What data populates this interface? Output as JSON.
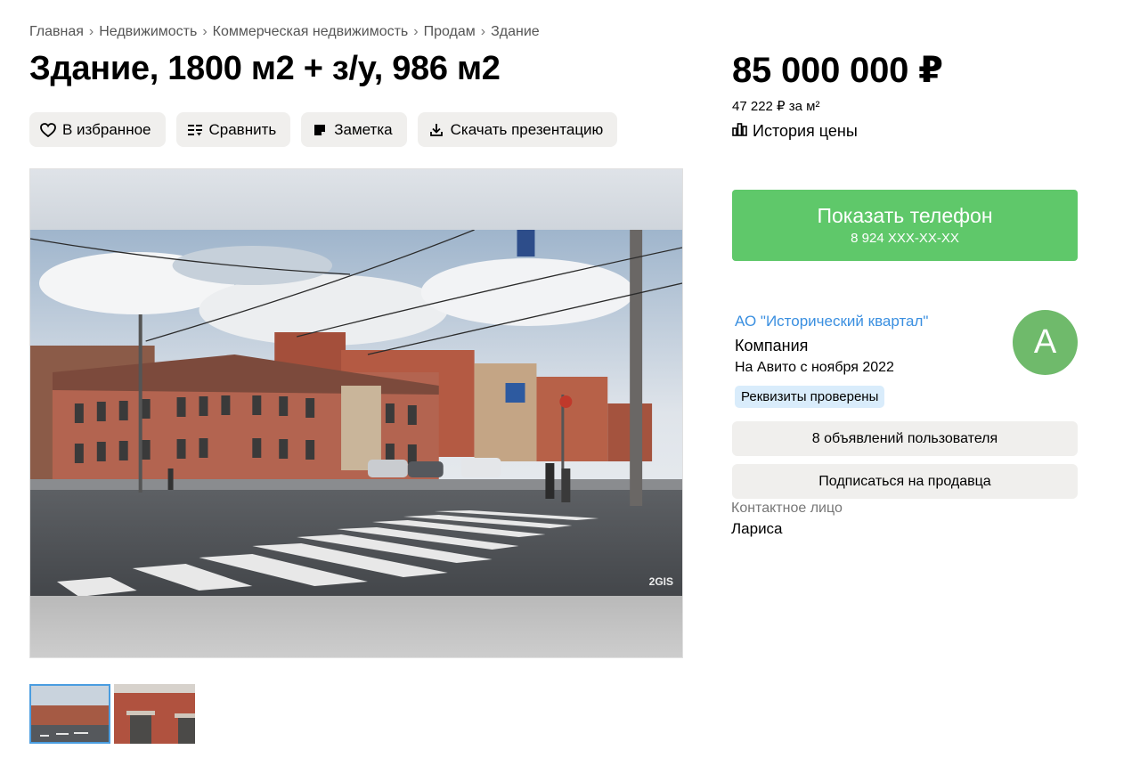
{
  "breadcrumb": [
    "Главная",
    "Недвижимость",
    "Коммерческая недвижимость",
    "Продам",
    "Здание"
  ],
  "title": "Здание, 1800 м2 + з/у, 986 м2",
  "actions": {
    "favorite": "В избранное",
    "compare": "Сравнить",
    "note": "Заметка",
    "download": "Скачать презентацию"
  },
  "icons": {
    "favorite": "heart-icon",
    "compare": "compare-icon",
    "note": "note-icon",
    "download": "download-icon",
    "history": "chart-icon"
  },
  "photo": {
    "watermark": "2GIS"
  },
  "price": {
    "total": "85 000 000 ₽",
    "per_m2": "47 222 ₽ за м²",
    "history_label": "История цены"
  },
  "phone_button": {
    "label": "Показать телефон",
    "number": "8 924 XXX-XX-XX",
    "color": "#5fc86a"
  },
  "seller": {
    "name": "АО \"Исторический квартал\"",
    "type": "Компания",
    "since": "На Авито с ноября 2022",
    "badge": "Реквизиты проверены",
    "avatar_letter": "А",
    "ads_button": "8 объявлений пользователя",
    "subscribe_button": "Подписаться на продавца",
    "contact_label": "Контактное лицо",
    "contact_name": "Лариса"
  }
}
